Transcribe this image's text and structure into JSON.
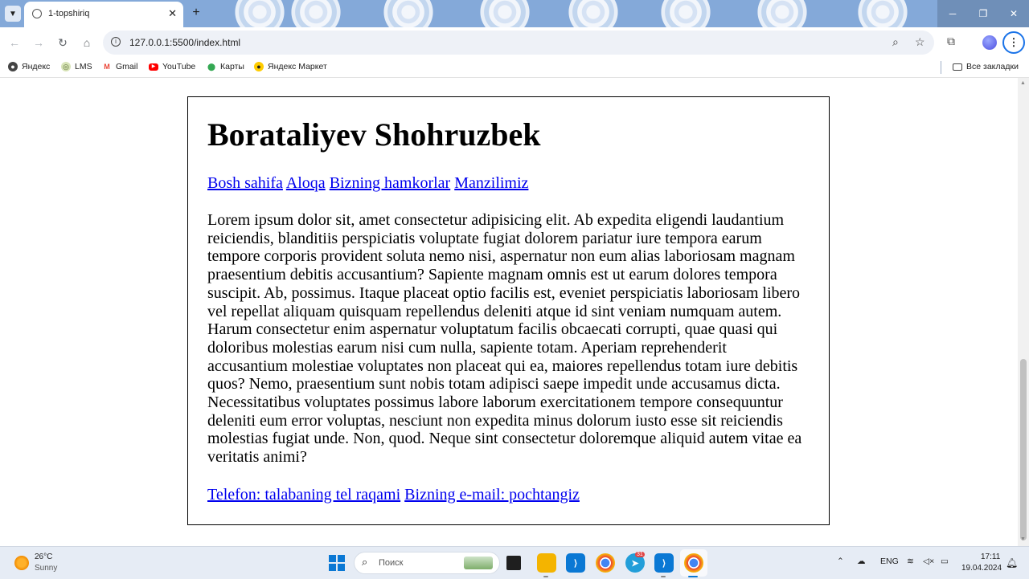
{
  "browser": {
    "tab_title": "1-topshiriq",
    "tab_close": "✕",
    "new_tab": "+",
    "url": "127.0.0.1:5500/index.html",
    "tab_list_icon": "chevron-down-icon",
    "window_controls": [
      "─",
      "❐",
      "✕"
    ],
    "bookmarks": [
      {
        "label": "Яндекс",
        "icon": "yandex-icon",
        "color": "#444444"
      },
      {
        "label": "LMS",
        "icon": "lms-icon",
        "color": "#6b8e23"
      },
      {
        "label": "Gmail",
        "icon": "gmail-icon",
        "color": "#ea4335"
      },
      {
        "label": "YouTube",
        "icon": "youtube-icon",
        "color": "#ff0000"
      },
      {
        "label": "Карты",
        "icon": "maps-icon",
        "color": "#34a853"
      },
      {
        "label": "Яндекс Маркет",
        "icon": "yandex-market-icon",
        "color": "#222222"
      }
    ],
    "all_bookmarks": "Все закладки"
  },
  "page": {
    "heading": "Borataliyev Shohruzbek",
    "nav_links": [
      "Bosh sahifa",
      "Aloqa",
      "Bizning hamkorlar",
      "Manzilimiz"
    ],
    "paragraph": "Lorem ipsum dolor sit, amet consectetur adipisicing elit. Ab expedita eligendi laudantium reiciendis, blanditiis perspiciatis voluptate fugiat dolorem pariatur iure tempora earum tempore corporis provident soluta nemo nisi, aspernatur non eum alias laboriosam magnam praesentium debitis accusantium? Sapiente magnam omnis est ut earum dolores tempora suscipit. Ab, possimus. Itaque placeat optio facilis est, eveniet perspiciatis laboriosam libero vel repellat aliquam quisquam repellendus deleniti atque id sint veniam numquam autem. Harum consectetur enim aspernatur voluptatum facilis obcaecati corrupti, quae quasi qui doloribus molestias earum nisi cum nulla, sapiente totam. Aperiam reprehenderit accusantium molestiae voluptates non placeat qui ea, maiores repellendus totam iure debitis quos? Nemo, praesentium sunt nobis totam adipisci saepe impedit unde accusamus dicta. Necessitatibus voluptates possimus labore laborum exercitationem tempore consequuntur deleniti eum error voluptas, nesciunt non expedita minus dolorum iusto esse sit reiciendis molestias fugiat unde. Non, quod. Neque sint consectetur doloremque aliquid autem vitae ea veritatis animi?",
    "contact_links": [
      "Telefon: talabaning tel raqami",
      "Bizning e-mail: pochtangiz"
    ],
    "link_color": "#0000ee"
  },
  "taskbar": {
    "weather_temp": "26°C",
    "weather_condition": "Sunny",
    "search_placeholder": "Поиск",
    "language": "ENG",
    "time": "17:11",
    "date": "19.04.2024",
    "telegram_badge": "31",
    "apps": [
      "windows-start-icon",
      "search-icon",
      "task-view-icon",
      "file-explorer-icon",
      "vscode-icon",
      "chrome-icon",
      "telegram-icon",
      "vscode-icon",
      "chrome-icon"
    ]
  },
  "colors": {
    "tab_strip": "#84a9d9",
    "accent": "#1a73e8"
  }
}
